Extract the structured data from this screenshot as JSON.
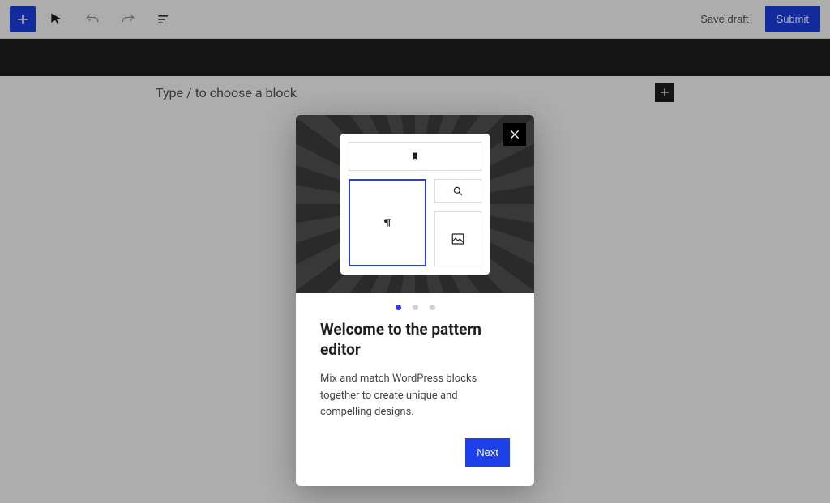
{
  "toolbar": {
    "save_draft_label": "Save draft",
    "submit_label": "Submit"
  },
  "editor": {
    "placeholder": "Type / to choose a block"
  },
  "modal": {
    "title": "Welcome to the pattern editor",
    "description": "Mix and match WordPress blocks together to create unique and compelling designs.",
    "next_label": "Next",
    "page_indicator": {
      "current": 1,
      "total": 3
    }
  },
  "icons": {
    "plus": "plus-icon",
    "cursor": "cursor-icon",
    "undo": "undo-icon",
    "redo": "redo-icon",
    "list": "list-view-icon",
    "close": "close-icon",
    "bookmark": "bookmark-icon",
    "paragraph": "paragraph-icon",
    "search": "search-icon",
    "image": "image-icon"
  }
}
